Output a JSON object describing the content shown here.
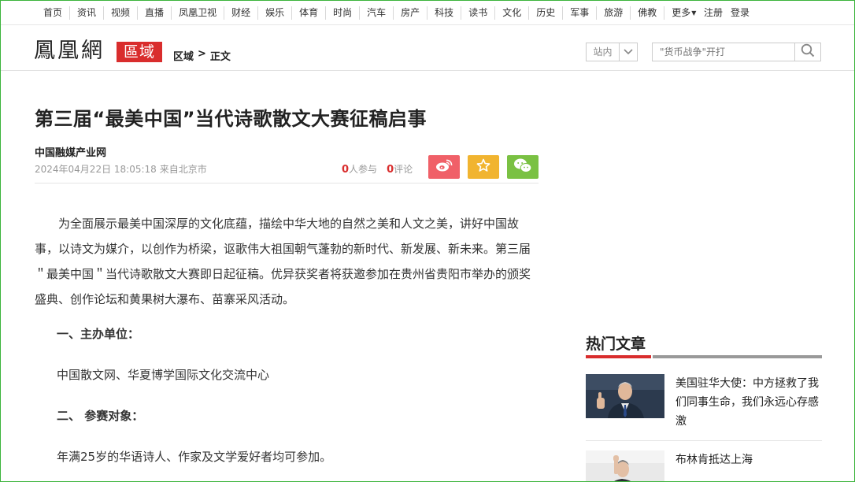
{
  "nav": {
    "items": [
      "首页",
      "资讯",
      "视频",
      "直播",
      "凤凰卫视",
      "财经",
      "娱乐",
      "体育",
      "时尚",
      "汽车",
      "房产",
      "科技",
      "读书",
      "文化",
      "历史",
      "军事",
      "旅游",
      "佛教"
    ],
    "more": "更多",
    "register": "注册",
    "login": "登录"
  },
  "header": {
    "logo": "鳳凰網",
    "badge": "區域",
    "breadcrumb": {
      "section": "区域",
      "sep": ">",
      "current": "正文"
    },
    "site_select": "站内",
    "search_placeholder": "\"货币战争\"开打"
  },
  "article": {
    "title": "第三届“最美中国”当代诗歌散文大赛征稿启事",
    "source": "中国融媒产业网",
    "date": "2024年04月22日 18:05:18",
    "origin": "来自北京市",
    "participants_count": "0",
    "participants_label": "人参与",
    "comments_count": "0",
    "comments_label": "评论",
    "para1": "为全面展示最美中国深厚的文化底蕴，描绘中华大地的自然之美和人文之美，讲好中国故事，以诗文为媒介，以创作为桥梁，讴歌伟大祖国朝气蓬勃的新时代、新发展、新未来。第三届＂最美中国＂当代诗歌散文大赛即日起征稿。优异获奖者将获邀参加在贵州省贵阳市举办的颁奖盛典、创作论坛和黄果树大瀑布、苗寨采风活动。",
    "section1_title": "一、主办单位：",
    "section1_text": "中国散文网、华夏博学国际文化交流中心",
    "section2_title": "二、 参赛对象：",
    "section2_text": "年满25岁的华语诗人、作家及文学爱好者均可参加。"
  },
  "sidebar": {
    "hot_title": "热门文章",
    "items": [
      {
        "text": "美国驻华大使：中方拯救了我们同事生命，我们永远心存感激"
      },
      {
        "text": "布林肯抵达上海"
      }
    ]
  },
  "colors": {
    "accent_red": "#d92d2d",
    "weibo": "#f06068",
    "favorite": "#f1b430",
    "wechat": "#7ac143",
    "frame": "#3cb43c"
  }
}
